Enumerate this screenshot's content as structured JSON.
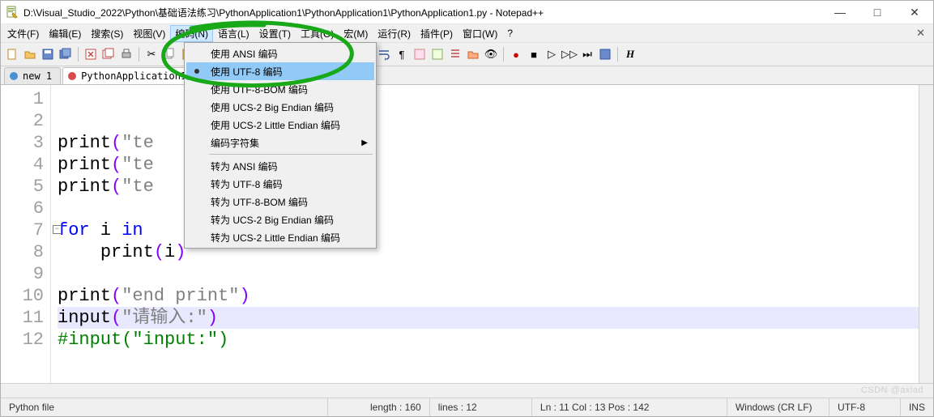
{
  "title": "D:\\Visual_Studio_2022\\Python\\基础语法练习\\PythonApplication1\\PythonApplication1\\PythonApplication1.py - Notepad++",
  "win_buttons": {
    "min": "—",
    "max": "□",
    "close": "✕"
  },
  "menu": {
    "items": [
      "文件(F)",
      "编辑(E)",
      "搜索(S)",
      "视图(V)",
      "编码(N)",
      "语言(L)",
      "设置(T)",
      "工具(O)",
      "宏(M)",
      "运行(R)",
      "插件(P)",
      "窗口(W)",
      "?"
    ],
    "active_index": 4
  },
  "tabs": [
    {
      "label": "new 1",
      "active": false
    },
    {
      "label": "PythonApplication1.py",
      "active": true
    }
  ],
  "dropdown": {
    "group1": [
      {
        "label": "使用 ANSI 编码",
        "bullet": false
      },
      {
        "label": "使用 UTF-8 编码",
        "bullet": true,
        "hl": true
      },
      {
        "label": "使用 UTF-8-BOM 编码",
        "bullet": false
      },
      {
        "label": "使用 UCS-2 Big Endian 编码",
        "bullet": false
      },
      {
        "label": "使用 UCS-2 Little Endian 编码",
        "bullet": false
      }
    ],
    "charset_label": "编码字符集",
    "group2": [
      {
        "label": "转为 ANSI 编码"
      },
      {
        "label": "转为 UTF-8 编码"
      },
      {
        "label": "转为 UTF-8-BOM 编码"
      },
      {
        "label": "转为 UCS-2 Big Endian 编码"
      },
      {
        "label": "转为 UCS-2 Little Endian 编码"
      }
    ]
  },
  "code_lines": [
    {
      "n": "1",
      "html": ""
    },
    {
      "n": "2",
      "html": ""
    },
    {
      "n": "3",
      "html": "<span class='fn'>print</span><span class='op'>(</span><span class='str'>\"te</span>"
    },
    {
      "n": "4",
      "html": "<span class='fn'>print</span><span class='op'>(</span><span class='str'>\"te</span>"
    },
    {
      "n": "5",
      "html": "<span class='fn'>print</span><span class='op'>(</span><span class='str'>\"te</span>"
    },
    {
      "n": "6",
      "html": ""
    },
    {
      "n": "7",
      "html": "<span class='kw'>for</span> i <span class='kw'>in</span> ",
      "fold": true
    },
    {
      "n": "8",
      "html": "    <span class='fn'>print</span><span class='op'>(</span>i<span class='op'>)</span>"
    },
    {
      "n": "9",
      "html": ""
    },
    {
      "n": "10",
      "html": "<span class='fn'>print</span><span class='op'>(</span><span class='str'>\"end print\"</span><span class='op'>)</span>"
    },
    {
      "n": "11",
      "html": "<span class='fn'>input</span><span class='op'>(</span><span class='str'>\"请输入:\"</span><span class='op'>)</span>",
      "hl": true
    },
    {
      "n": "12",
      "html": "<span class='cm'>#input(\"input:\")</span>"
    }
  ],
  "status": {
    "lang": "Python file",
    "length": "length : 160",
    "lines": "lines : 12",
    "pos": "Ln : 11   Col : 13   Pos : 142",
    "eol": "Windows (CR LF)",
    "enc": "UTF-8",
    "ins": "INS"
  },
  "watermark": "CSDN @axlad",
  "icons": {
    "app": "📝"
  }
}
